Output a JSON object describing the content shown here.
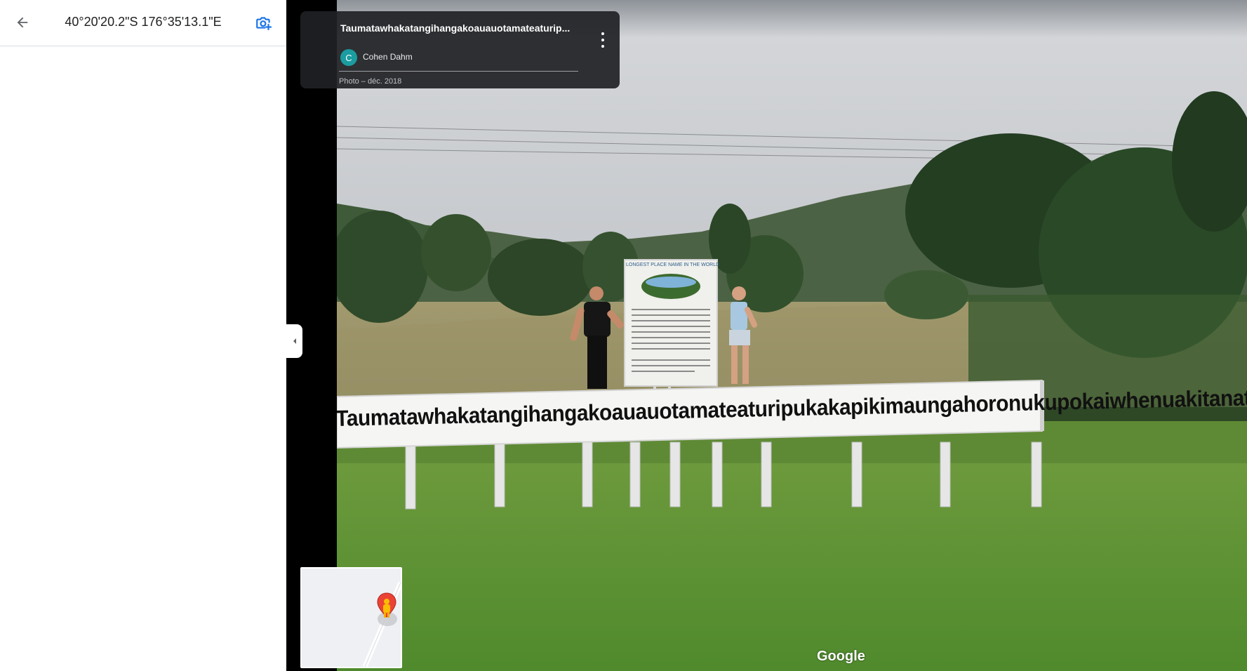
{
  "header": {
    "coordinates": "40°20'20.2\"S 176°35'13.1\"E",
    "back_icon": "arrow-left-icon",
    "add_photo_icon": "camera-plus-icon"
  },
  "photo_card": {
    "title": "Taumatawhakatangihangakoauauotamateaturip...",
    "author_initial": "C",
    "author_name": "Cohen Dahm",
    "meta": "Photo – déc. 2018",
    "avatar_color": "#1a9ca0"
  },
  "scene": {
    "long_sign_text": "Taumatawhakatangihangakoauauotamateaturipukakapikimaungahoronukupokaiwhenuakitanatahu",
    "board_heading": "LONGEST PLACE NAME IN THE WORLD"
  },
  "minimap": {
    "pegman_icon": "pegman-icon",
    "marker_icon": "map-pin-icon"
  },
  "footer": {
    "logo": "Google"
  },
  "colors": {
    "accent_blue": "#1a73e8",
    "card_bg": "#202124"
  }
}
